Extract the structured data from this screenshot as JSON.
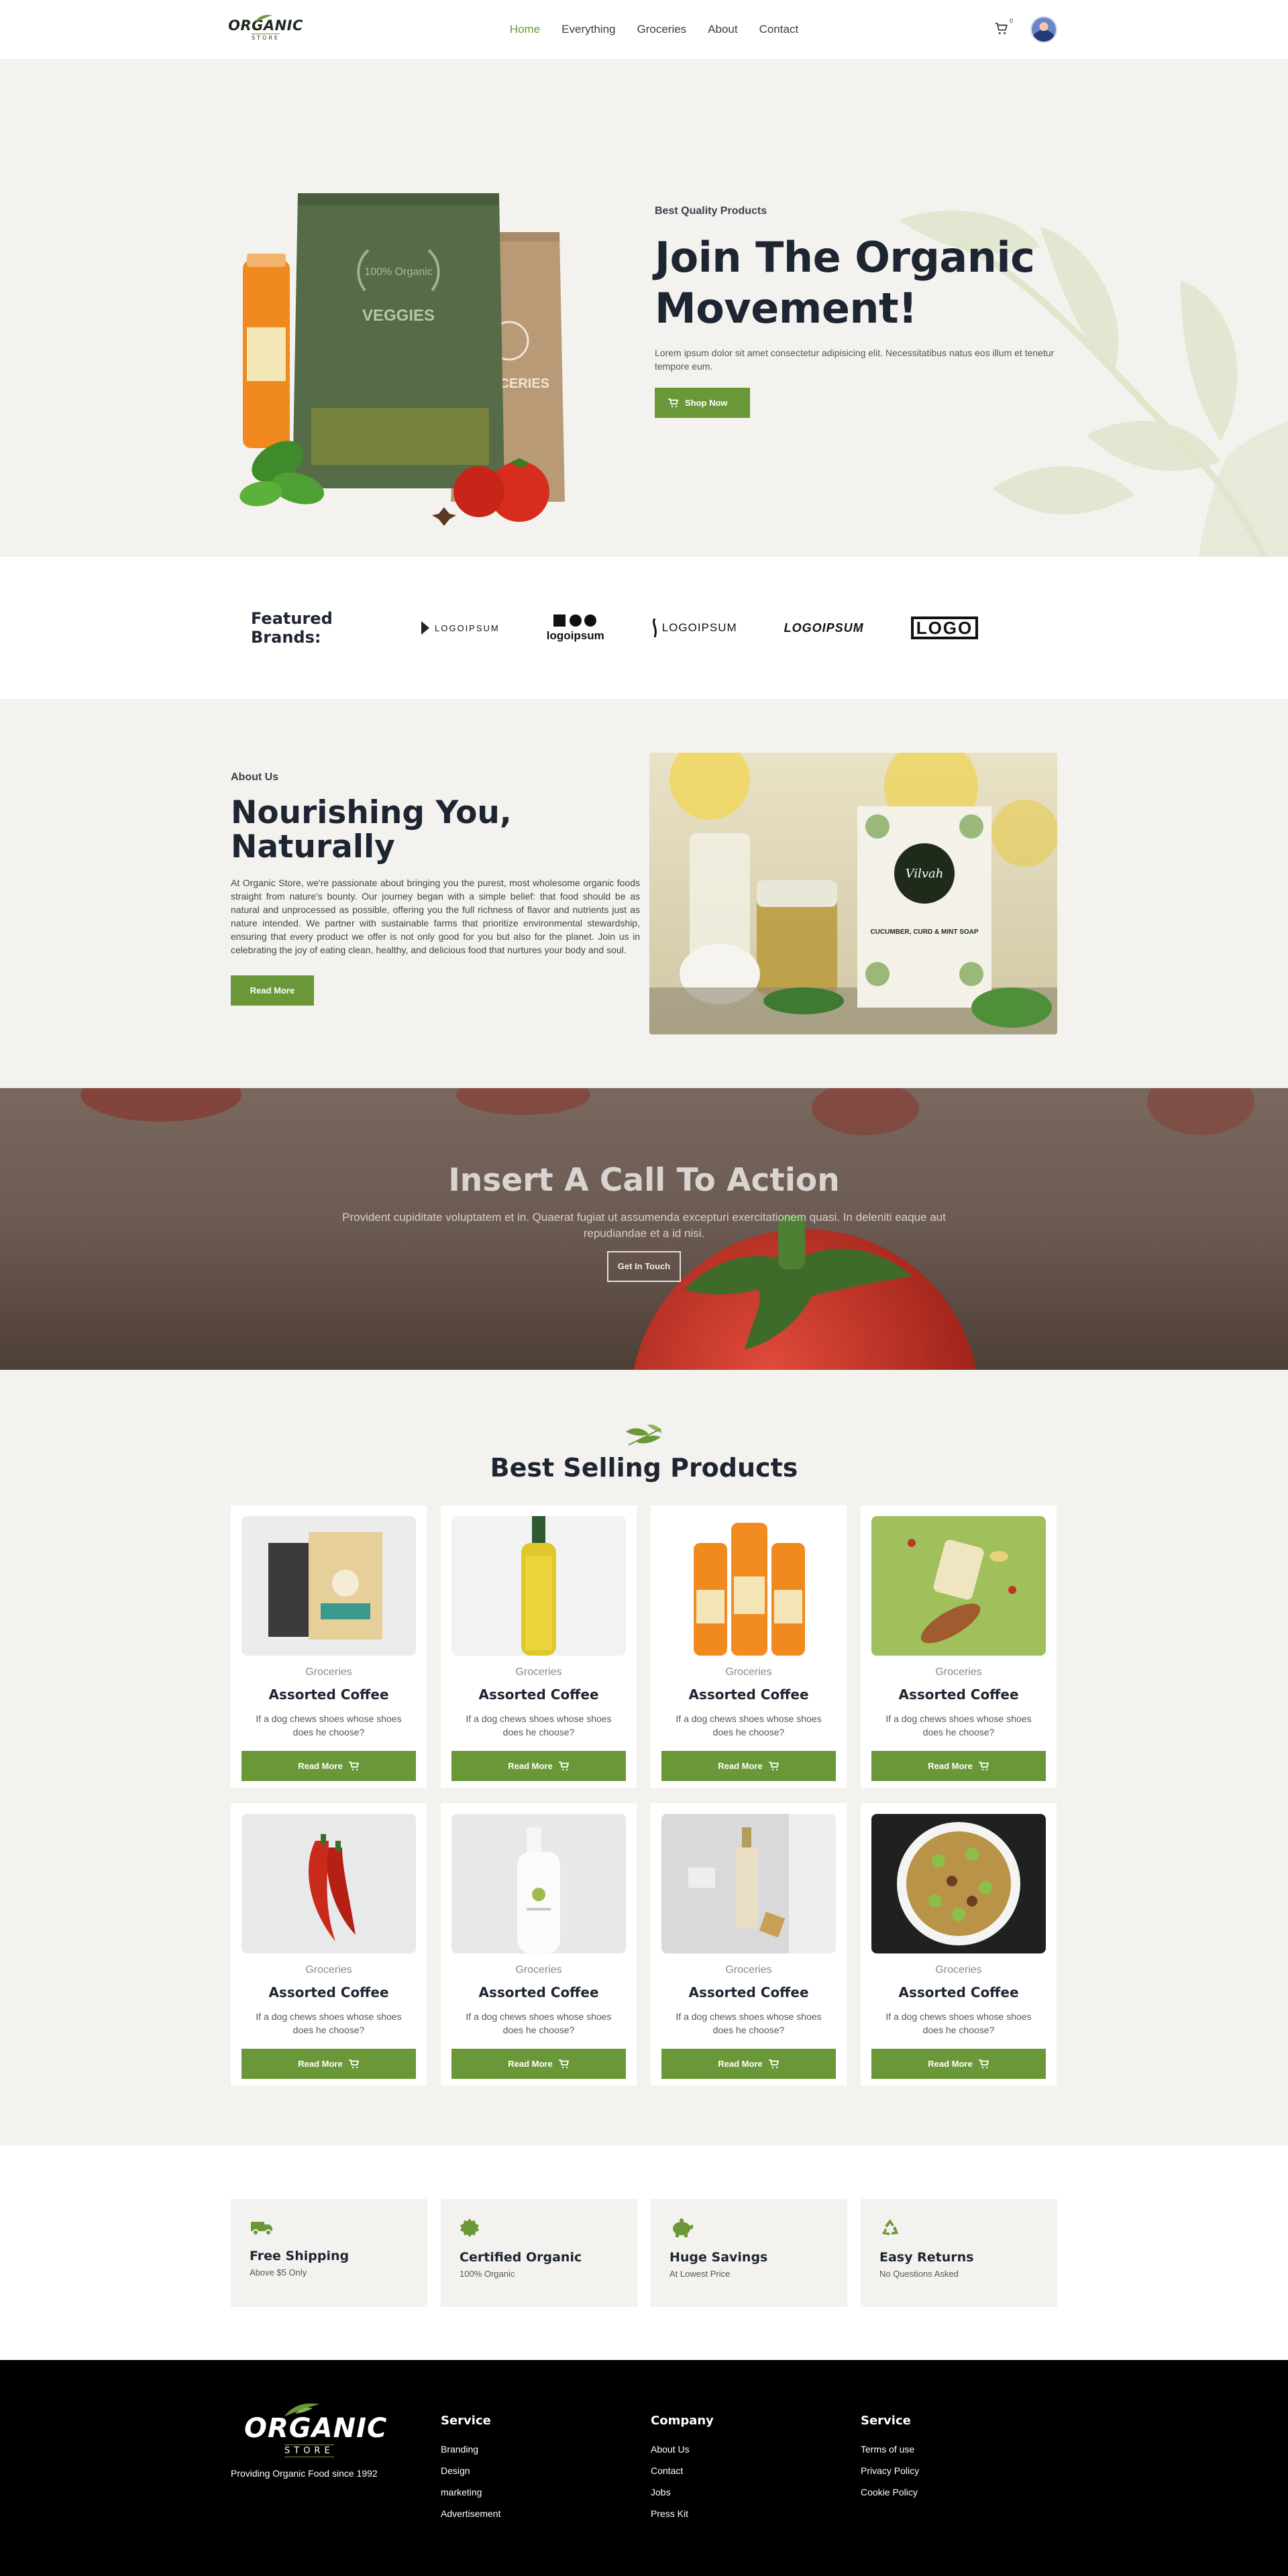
{
  "nav": {
    "logo_word": "ORGANIC",
    "logo_sub": "STORE",
    "items": [
      {
        "label": "Home",
        "active": true
      },
      {
        "label": "Everything",
        "active": false
      },
      {
        "label": "Groceries",
        "active": false
      },
      {
        "label": "About",
        "active": false
      },
      {
        "label": "Contact",
        "active": false
      }
    ],
    "cart_count": "0",
    "accent": "#6a9838"
  },
  "hero": {
    "eyebrow": "Best Quality Products",
    "title": "Join The Organic Movement!",
    "text": "Lorem ipsum dolor sit amet consectetur adipisicing elit. Necessitatibus natus eos illum et tenetur tempore eum.",
    "button": "Shop Now",
    "bag_front_label": "VEGGIES",
    "bag_back_label": "GROCERIES",
    "bag_badge": "100% Organic"
  },
  "brands": {
    "label": "Featured Brands:",
    "logos": [
      "LOGOIPSUM",
      "logoipsum",
      "LOGOIPSUM",
      "LOGOIPSUM",
      "LOGO"
    ]
  },
  "about": {
    "eyebrow": "About Us",
    "title": "Nourishing You, Naturally",
    "text": "At Organic Store, we're passionate about bringing you the purest, most wholesome organic foods straight from nature's bounty. Our journey began with a simple belief: that food should be as natural and unprocessed as possible, offering you the full richness of flavor and nutrients just as nature intended. We partner with sustainable farms that prioritize environmental stewardship, ensuring that every product we offer is not only good for you but also for the planet. Join us in celebrating the joy of eating clean, healthy, and delicious food that nurtures your body and soul.",
    "button": "Read More",
    "soap_brand": "Vilvah",
    "soap_label": "CUCUMBER, CURD & MINT SOAP"
  },
  "cta": {
    "title": "Insert A Call To Action",
    "text": "Provident cupiditate voluptatem et in. Quaerat fugiat ut assumenda excepturi exercitationem quasi. In deleniti eaque aut repudiandae et a id nisi.",
    "button": "Get In Touch"
  },
  "products": {
    "title": "Best Selling Products",
    "items": [
      {
        "category": "Groceries",
        "title": "Assorted Coffee",
        "desc": "If a dog chews shoes whose shoes does he choose?",
        "button": "Read More",
        "image": "coffee-bags"
      },
      {
        "category": "Groceries",
        "title": "Assorted Coffee",
        "desc": "If a dog chews shoes whose shoes does he choose?",
        "button": "Read More",
        "image": "oil-bottle"
      },
      {
        "category": "Groceries",
        "title": "Assorted Coffee",
        "desc": "If a dog chews shoes whose shoes does he choose?",
        "button": "Read More",
        "image": "juice-bottles"
      },
      {
        "category": "Groceries",
        "title": "Assorted Coffee",
        "desc": "If a dog chews shoes whose shoes does he choose?",
        "button": "Read More",
        "image": "jar-board"
      },
      {
        "category": "Groceries",
        "title": "Assorted Coffee",
        "desc": "If a dog chews shoes whose shoes does he choose?",
        "button": "Read More",
        "image": "red-chilies"
      },
      {
        "category": "Groceries",
        "title": "Assorted Coffee",
        "desc": "If a dog chews shoes whose shoes does he choose?",
        "button": "Read More",
        "image": "lotion-bottle"
      },
      {
        "category": "Groceries",
        "title": "Assorted Coffee",
        "desc": "If a dog chews shoes whose shoes does he choose?",
        "button": "Read More",
        "image": "serum-bottle"
      },
      {
        "category": "Groceries",
        "title": "Assorted Coffee",
        "desc": "If a dog chews shoes whose shoes does he choose?",
        "button": "Read More",
        "image": "salad-bowl"
      }
    ]
  },
  "features": [
    {
      "title": "Free Shipping",
      "sub": "Above $5 Only",
      "icon": "truck-icon"
    },
    {
      "title": "Certified Organic",
      "sub": "100% Organic",
      "icon": "badge-icon"
    },
    {
      "title": "Huge Savings",
      "sub": "At Lowest Price",
      "icon": "piggy-bank-icon"
    },
    {
      "title": "Easy Returns",
      "sub": "No Questions Asked",
      "icon": "recycle-icon"
    }
  ],
  "footer": {
    "logo_word": "ORGANIC",
    "logo_sub": "STORE",
    "tagline": "Providing Organic Food since 1992",
    "columns": [
      {
        "title": "Service",
        "links": [
          "Branding",
          "Design",
          "marketing",
          "Advertisement"
        ]
      },
      {
        "title": "Company",
        "links": [
          "About Us",
          "Contact",
          "Jobs",
          "Press Kit"
        ]
      },
      {
        "title": "Service",
        "links": [
          "Terms of use",
          "Privacy Policy",
          "Cookie Policy"
        ]
      }
    ]
  }
}
